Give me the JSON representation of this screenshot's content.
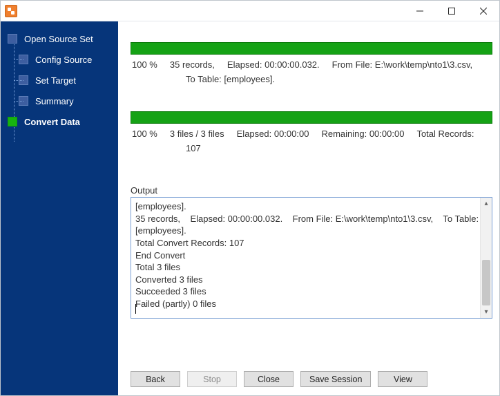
{
  "window": {
    "title": ""
  },
  "sidebar": {
    "items": [
      {
        "label": "Open Source Set",
        "active": false
      },
      {
        "label": "Config Source",
        "active": false
      },
      {
        "label": "Set Target",
        "active": false
      },
      {
        "label": "Summary",
        "active": false
      },
      {
        "label": "Convert Data",
        "active": true
      }
    ]
  },
  "progress": {
    "file": {
      "percent": "100 %",
      "records": "35 records,",
      "elapsed": "Elapsed: 00:00:00.032.",
      "from": "From File: E:\\work\\temp\\nto1\\3.csv,",
      "to": "To Table: [employees]."
    },
    "total": {
      "percent": "100 %",
      "files": "3 files / 3 files",
      "elapsed": "Elapsed: 00:00:00",
      "remaining": "Remaining: 00:00:00",
      "totalrec": "Total Records:",
      "totalrec_value": "107"
    }
  },
  "output": {
    "label": "Output",
    "lines": [
      "[employees].",
      "35 records,    Elapsed: 00:00:00.032.    From File: E:\\work\\temp\\nto1\\3.csv,    To Table: [employees].",
      "Total Convert Records: 107",
      "End Convert",
      "Total 3 files",
      "Converted 3 files",
      "Succeeded 3 files",
      "Failed (partly) 0 files"
    ]
  },
  "buttons": {
    "back": "Back",
    "stop": "Stop",
    "close": "Close",
    "save": "Save Session",
    "view": "View"
  },
  "colors": {
    "sidebar_bg": "#06357a",
    "progress_green": "#15a215"
  }
}
